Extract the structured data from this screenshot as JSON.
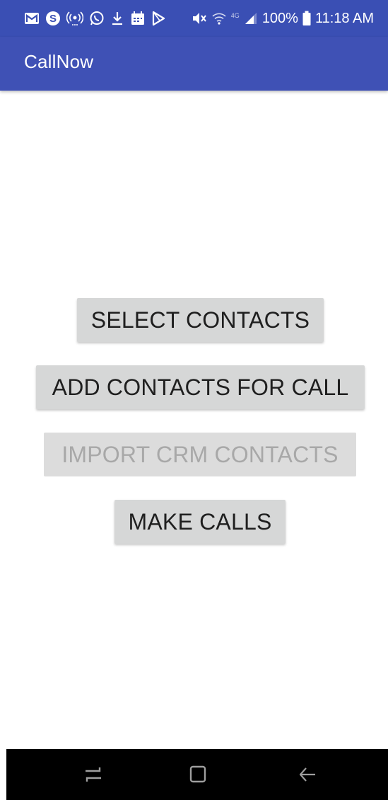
{
  "status_bar": {
    "battery": "100%",
    "time": "11:18 AM",
    "network": "4G",
    "icons_left": [
      "gmail-icon",
      "skype-icon",
      "hotspot-icon",
      "whatsapp-icon",
      "download-icon",
      "calendar-icon",
      "play-store-icon"
    ],
    "icons_right": [
      "mute-icon",
      "wifi-icon",
      "signal-icon",
      "battery-icon"
    ]
  },
  "app_bar": {
    "title": "CallNow"
  },
  "main": {
    "buttons": [
      {
        "label": "SELECT CONTACTS",
        "enabled": true
      },
      {
        "label": "ADD CONTACTS FOR CALL",
        "enabled": true
      },
      {
        "label": "IMPORT CRM CONTACTS",
        "enabled": false
      },
      {
        "label": "MAKE CALLS",
        "enabled": true
      }
    ]
  },
  "nav_bar": {
    "icons": [
      "recents-icon",
      "home-icon",
      "back-icon"
    ]
  },
  "colors": {
    "primary": "#3f51b5",
    "status_bar": "#3a4fb4",
    "button_bg": "#d6d7d7",
    "button_text": "#1f1f1f",
    "button_disabled_text": "#a8a8a8",
    "nav_bar": "#000000"
  }
}
